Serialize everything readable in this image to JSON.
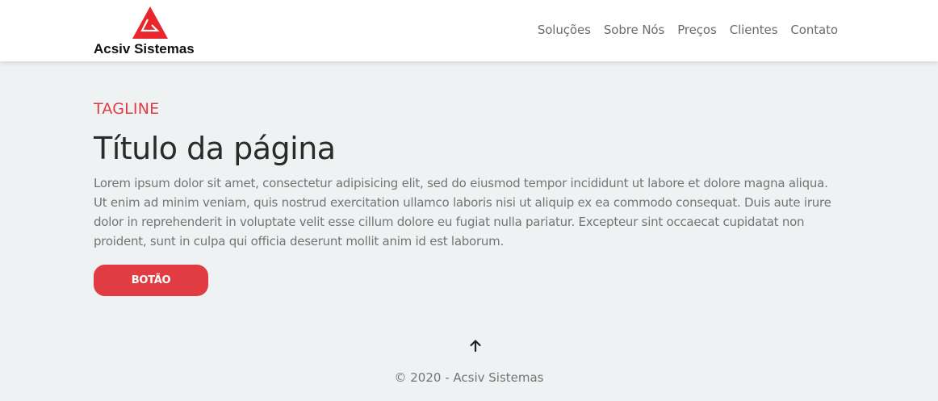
{
  "brand": {
    "name": "Acsiv Sistemas",
    "logo_color": "#e8262c"
  },
  "nav": {
    "items": [
      {
        "label": "Soluções"
      },
      {
        "label": "Sobre Nós"
      },
      {
        "label": "Preços"
      },
      {
        "label": "Clientes"
      },
      {
        "label": "Contato"
      }
    ]
  },
  "hero": {
    "tagline": "TAGLINE",
    "title": "Título da página",
    "body": "Lorem ipsum dolor sit amet, consectetur adipisicing elit, sed do eiusmod tempor incididunt ut labore et dolore magna aliqua. Ut enim ad minim veniam, quis nostrud exercitation ullamco laboris nisi ut aliquip ex ea commodo consequat. Duis aute irure dolor in reprehenderit in voluptate velit esse cillum dolore eu fugiat nulla pariatur. Excepteur sint occaecat cupidatat non proident, sunt in culpa qui officia deserunt mollit anim id est laborum.",
    "button_label": "BOTÃO"
  },
  "footer": {
    "back_to_top_icon": "arrow-up-icon",
    "copyright": "© 2020 - Acsiv Sistemas"
  },
  "colors": {
    "accent": "#e03c41",
    "background": "#eff2f3",
    "navbar": "#ffffff",
    "text": "#2a2a2a",
    "muted": "#747474"
  }
}
